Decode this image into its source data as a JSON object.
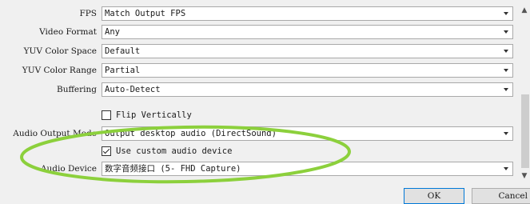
{
  "rows": [
    {
      "label": "FPS",
      "value": "Match Output FPS"
    },
    {
      "label": "Video Format",
      "value": "Any"
    },
    {
      "label": "YUV Color Space",
      "value": "Default"
    },
    {
      "label": "YUV Color Range",
      "value": "Partial"
    },
    {
      "label": "Buffering",
      "value": "Auto-Detect"
    },
    {
      "label": "Audio Output Mode",
      "value": "Output desktop audio (DirectSound)"
    },
    {
      "label": "Audio Device",
      "value": "数字音频接口 (5- FHD Capture)"
    }
  ],
  "flip_vertically": {
    "label": "Flip Vertically",
    "checked": false
  },
  "use_custom_audio": {
    "label": "Use custom audio device",
    "checked": true
  },
  "buttons": {
    "ok": "OK",
    "cancel": "Cancel"
  },
  "colors": {
    "highlight_ellipse": "#8cd03c"
  }
}
